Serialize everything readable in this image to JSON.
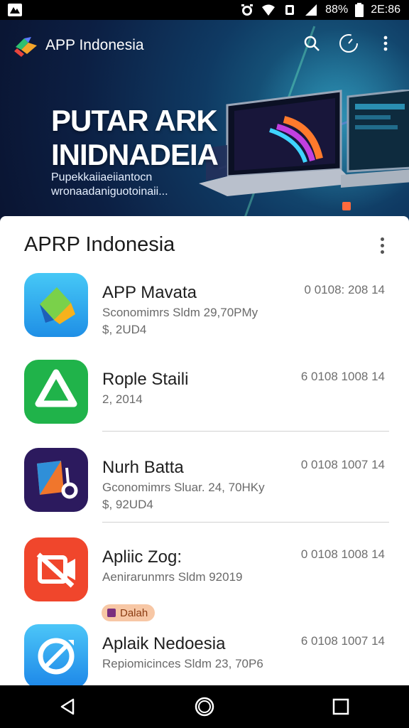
{
  "status_bar": {
    "battery": "88%",
    "time": "2E:86"
  },
  "header": {
    "app_title": "APP Indonesia",
    "icons": [
      "search-icon",
      "speedometer-icon",
      "more-vert-icon"
    ]
  },
  "hero": {
    "title": "PUTAR ARK INIDNADEIA",
    "subtitle": "Pupekkaiiaeiiantocn wronaadaniguotoinaii..."
  },
  "list": {
    "title": "APRP Indonesia",
    "items": [
      {
        "name": "APP Mavata",
        "meta1": "Sconomimrs Sldm 29,70PMy",
        "meta2": "$, 2UD4",
        "date": "0 0108: 208 14"
      },
      {
        "name": "Rople Staili",
        "meta1": "2, 2014",
        "meta2": "",
        "date": "6 0108 1008 14"
      },
      {
        "name": "Nurh Batta",
        "meta1": "Gconomimrs Sluar. 24, 70HKy",
        "meta2": "$, 92UD4",
        "date": "0 0108 1007 14"
      },
      {
        "name": "Apliic Zog:",
        "meta1": "Aenirarunmrs Sldm 92019",
        "meta2": "",
        "date": "0 0108 1008 14"
      },
      {
        "name": "Aplaik Nedoesia",
        "meta1": "Repiomicinces Sldm 23, 70P6",
        "meta2": "",
        "date": "6 0108 1007 14"
      }
    ],
    "chip": "Dalah"
  },
  "colors": {
    "accent_blue": "#2aa1f0",
    "green": "#22b04b",
    "orange_red": "#f0462c",
    "purple": "#3a1f6b"
  }
}
